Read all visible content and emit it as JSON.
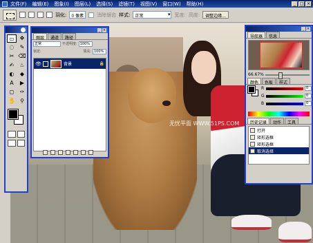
{
  "menubar": {
    "items": [
      "文件(F)",
      "编辑(E)",
      "图象(I)",
      "图层(L)",
      "选择(S)",
      "滤镜(T)",
      "视图(V)",
      "窗口(W)",
      "帮助(H)"
    ],
    "win_buttons": [
      "_",
      "□",
      "×"
    ]
  },
  "options": {
    "feather_label": "羽化:",
    "feather_value": "0 像素",
    "antialias_label": "消除锯齿",
    "style_label": "样式:",
    "style_value": "正常",
    "width_label": "宽度:",
    "height_label": "高度:",
    "refine_button": "调整边缘..."
  },
  "canvas": {
    "watermark": "无忧平面 WWW.51PS.COM"
  },
  "toolbox": {
    "tools": [
      "▭",
      "✥",
      "◌",
      "✎",
      "✂",
      "⌫",
      "✍",
      "♨",
      "◐",
      "◆",
      "A",
      "▶",
      "◻",
      "✑",
      "✋",
      "⚲"
    ]
  },
  "layers_palette": {
    "tabs": [
      "图层",
      "通道",
      "路径"
    ],
    "blend_mode": "正常",
    "opacity_label": "不透明度:",
    "opacity_value": "100%",
    "lock_label": "锁定:",
    "fill_label": "填充:",
    "fill_value": "100%",
    "layer_name": "背景"
  },
  "navigator": {
    "tabs": [
      "导航器",
      "信息"
    ],
    "zoom": "66.67%"
  },
  "color": {
    "tabs": [
      "颜色",
      "色板",
      "样式"
    ],
    "r_label": "R",
    "g_label": "G",
    "b_label": "B",
    "r_value": "0",
    "g_value": "0",
    "b_value": "0"
  },
  "history": {
    "tabs": [
      "历史记录",
      "动作",
      "工具"
    ],
    "items": [
      "打开",
      "矩形选框",
      "矩形选框",
      "取消选择"
    ]
  }
}
